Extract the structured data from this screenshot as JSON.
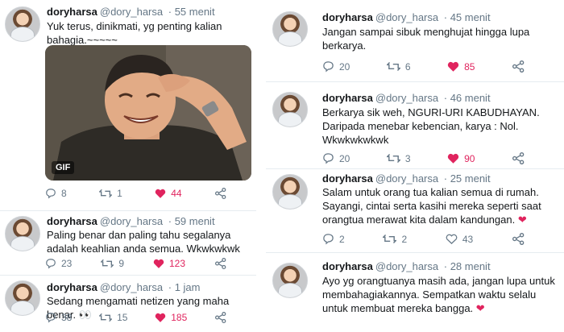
{
  "left": {
    "tweets": [
      {
        "name": "doryharsa",
        "handle": "@dory_harsa",
        "time": "· 55 menit",
        "text": "Yuk terus, dinikmati, yg penting kalian bahagia.~~~~~",
        "gif_label": "GIF",
        "replies": "8",
        "retweets": "1",
        "likes": "44"
      },
      {
        "name": "doryharsa",
        "handle": "@dory_harsa",
        "time": "· 59 menit",
        "text": "Paling benar dan paling tahu segalanya adalah keahlian anda semua. Wkwkwkwk",
        "replies": "23",
        "retweets": "9",
        "likes": "123"
      },
      {
        "name": "doryharsa",
        "handle": "@dory_harsa",
        "time": "· 1 jam",
        "text": "Sedang mengamati netizen yang maha benar. 👀",
        "replies": "38",
        "retweets": "15",
        "likes": "185"
      }
    ]
  },
  "right": {
    "tweets": [
      {
        "name": "doryharsa",
        "handle": "@dory_harsa",
        "time": "· 45 menit",
        "text": "Jangan sampai sibuk menghujat hingga lupa berkarya.",
        "replies": "20",
        "retweets": "6",
        "likes": "85"
      },
      {
        "name": "doryharsa",
        "handle": "@dory_harsa",
        "time": "· 46 menit",
        "text": "Berkarya sik weh, NGURI-URI KABUDHAYAN. Daripada menebar kebencian, karya : Nol. Wkwkwkwkwk",
        "replies": "20",
        "retweets": "3",
        "likes": "90"
      },
      {
        "name": "doryharsa",
        "handle": "@dory_harsa",
        "time": "· 25 menit",
        "text": "Salam untuk orang tua kalian semua di rumah. Sayangi, cintai serta kasihi mereka seperti saat orangtua merawat kita dalam kandungan.",
        "emoji": "❤",
        "replies": "2",
        "retweets": "2",
        "likes": "43"
      },
      {
        "name": "doryharsa",
        "handle": "@dory_harsa",
        "time": "· 28 menit",
        "text": "Ayo yg orangtuanya masih ada, jangan lupa untuk membahagiakannya. Sempatkan waktu selalu untuk membuat mereka bangga.",
        "emoji": "❤"
      }
    ]
  },
  "icons": {
    "reply": "reply-icon",
    "retweet": "retweet-icon",
    "like": "heart-icon",
    "share": "share-icon"
  },
  "colors": {
    "like_active": "#e0245e",
    "muted": "#657786",
    "retweet": "#17bf63",
    "divider": "#e6ecf0"
  }
}
